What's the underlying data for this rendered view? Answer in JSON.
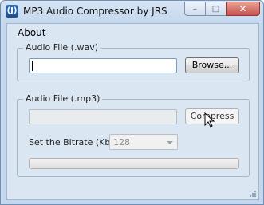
{
  "window": {
    "title": "MP3 Audio Compressor by JRS",
    "icon_text": "(J)",
    "controls": {
      "minimize": "–",
      "maximize": "□",
      "close": "✕"
    }
  },
  "menu": {
    "about": "About"
  },
  "wav_group": {
    "legend": "Audio File (.wav)",
    "input_value": "",
    "browse_label": "Browse..."
  },
  "mp3_group": {
    "legend": "Audio File (.mp3)",
    "output_value": "",
    "compress_label": "Compress",
    "bitrate_label": "Set the Bitrate (Kbps)",
    "bitrate_value": "128",
    "progress": 0
  }
}
